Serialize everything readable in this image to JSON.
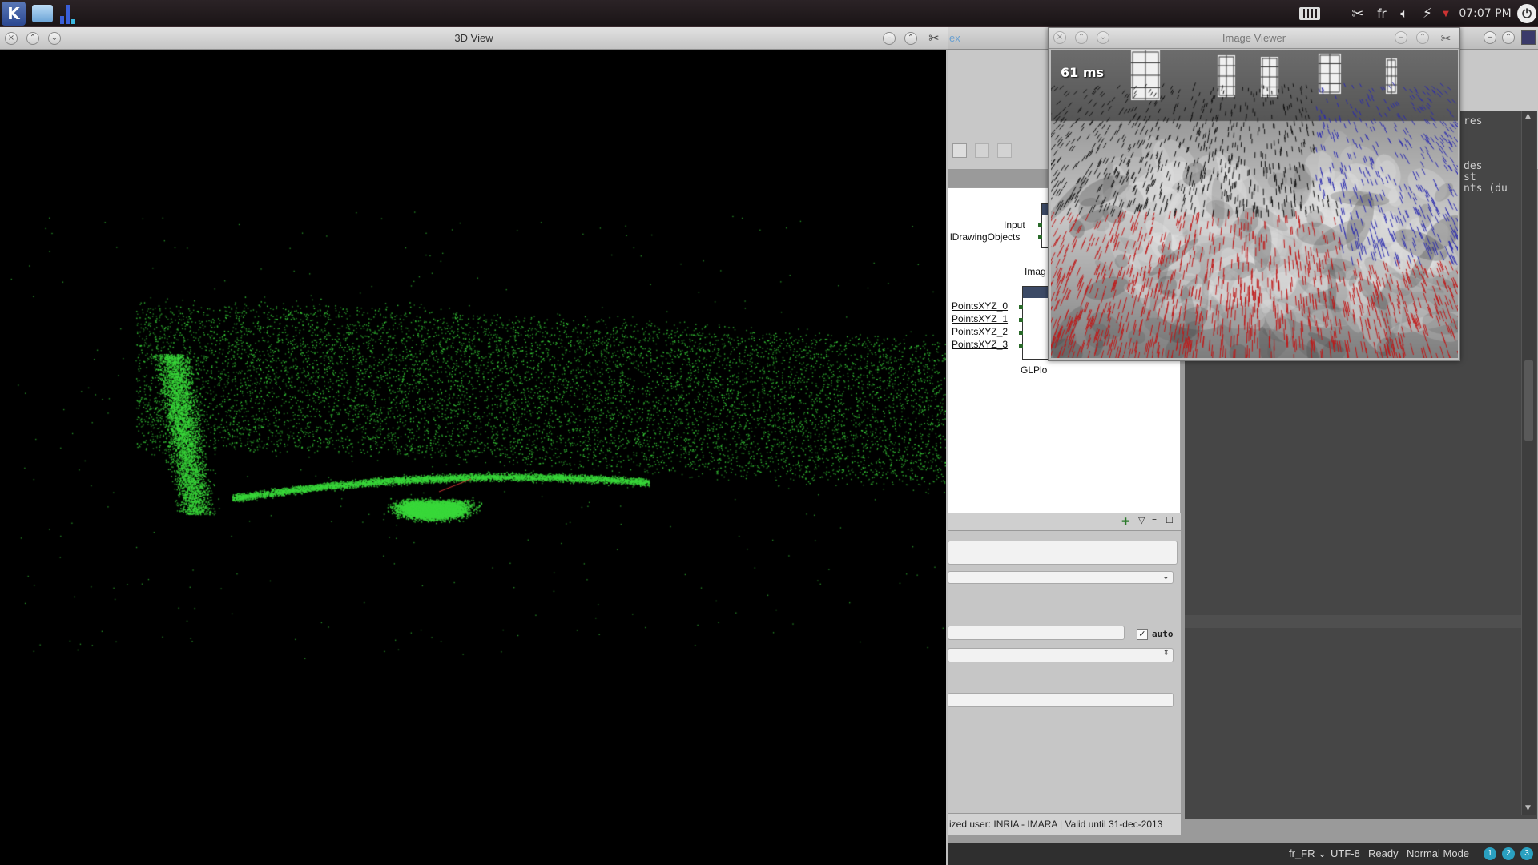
{
  "taskbar": {
    "kmenu_glyph": "K",
    "tray": {
      "language": "fr",
      "clock": "07:07 PM"
    }
  },
  "view3d_window": {
    "title": "3D View"
  },
  "image_viewer_window": {
    "title": "Image Viewer",
    "overlay_text": "61 ms"
  },
  "background_app": {
    "title_fragment": "ex",
    "canvas": {
      "node_image": {
        "label": "Imag",
        "ports": [
          "Input",
          "lDrawingObjects"
        ]
      },
      "node_glplot": {
        "label": "GLPlo",
        "ports": [
          "PointsXYZ_0",
          "PointsXYZ_1",
          "PointsXYZ_2",
          "PointsXYZ_3"
        ]
      }
    },
    "properties": {
      "auto_label": "auto",
      "auto_checked_glyph": "✓"
    },
    "license_text": "ized user: INRIA - IMARA | Valid until 31-dec-2013",
    "console_lines": [
      "res",
      "",
      "",
      "",
      "des",
      "st",
      "nts (du"
    ],
    "statusbar": {
      "locale": "fr_FR ⌄",
      "encoding": "UTF-8",
      "status": "Ready",
      "mode": "Normal Mode",
      "badges": [
        "1",
        "2",
        "3"
      ]
    }
  },
  "colors": {
    "point_cloud": "#39d83a",
    "flow_near": "#c01818",
    "flow_far": "#2a2ab0",
    "flow_mid": "#111111"
  }
}
